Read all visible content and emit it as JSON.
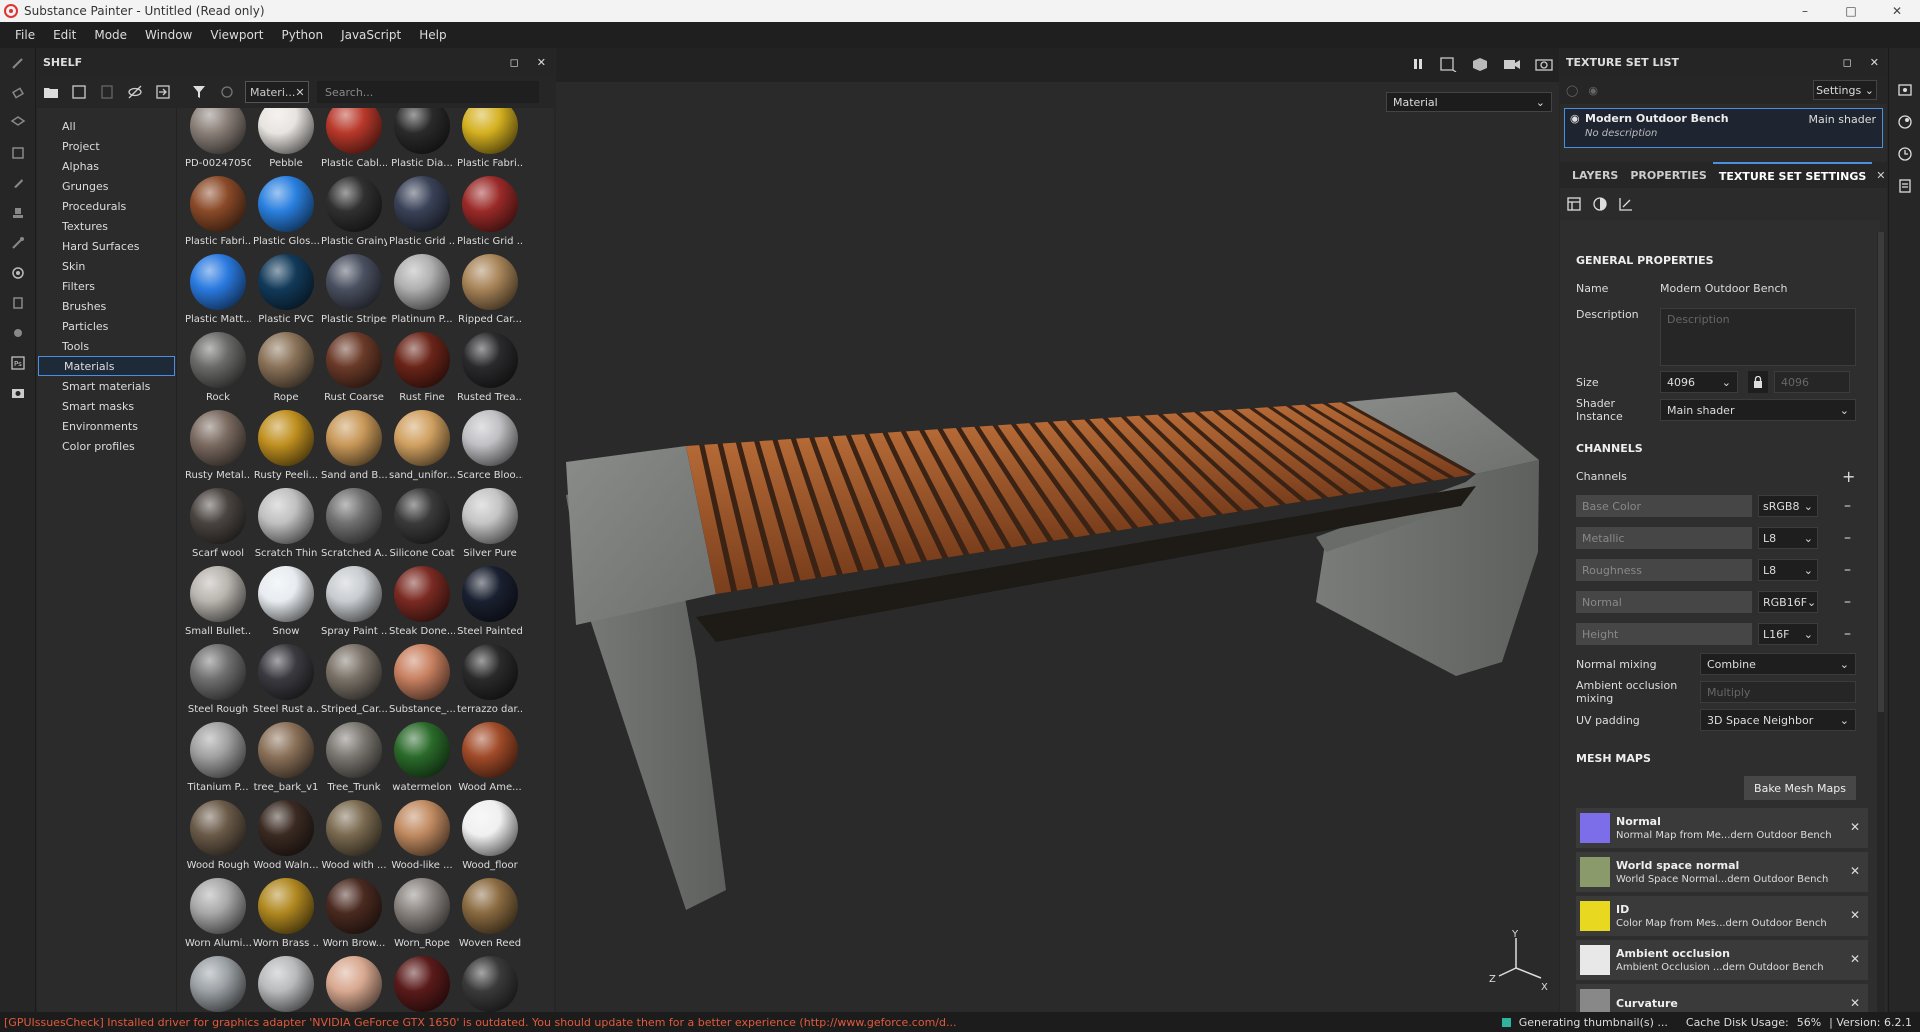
{
  "window": {
    "title": "Substance Painter - Untitled (Read only)"
  },
  "menu": [
    "File",
    "Edit",
    "Mode",
    "Window",
    "Viewport",
    "Python",
    "JavaScript",
    "Help"
  ],
  "shelf": {
    "title": "SHELF",
    "filter_chip": "Materi...",
    "search_placeholder": "Search...",
    "categories": [
      "All",
      "Project",
      "Alphas",
      "Grunges",
      "Procedurals",
      "Textures",
      "Hard Surfaces",
      "Skin",
      "Filters",
      "Brushes",
      "Particles",
      "Tools",
      "Materials",
      "Smart materials",
      "Smart masks",
      "Environments",
      "Color profiles"
    ],
    "selected_category": "Materials",
    "materials": [
      {
        "name": "PD-00247050",
        "color": "#8a7f78"
      },
      {
        "name": "Pebble",
        "color": "#e8e4e0"
      },
      {
        "name": "Plastic Cabl...",
        "color": "#b8382a"
      },
      {
        "name": "Plastic Dia...",
        "color": "#2a2a2a"
      },
      {
        "name": "Plastic Fabri...",
        "color": "#d4b020"
      },
      {
        "name": "Plastic Fabri...",
        "color": "#8a4a28"
      },
      {
        "name": "Plastic Glos...",
        "color": "#2a80e0"
      },
      {
        "name": "Plastic Grainy",
        "color": "#303030"
      },
      {
        "name": "Plastic Grid ...",
        "color": "#3a4258"
      },
      {
        "name": "Plastic Grid ...",
        "color": "#9a2a28"
      },
      {
        "name": "Plastic Matt...",
        "color": "#2a7ae0"
      },
      {
        "name": "Plastic PVC",
        "color": "#123a5a"
      },
      {
        "name": "Plastic Stripes",
        "color": "#4a5060"
      },
      {
        "name": "Platinum P...",
        "color": "#b0b0b0"
      },
      {
        "name": "Ripped Car...",
        "color": "#a88458"
      },
      {
        "name": "Rock",
        "color": "#6a6a68"
      },
      {
        "name": "Rope",
        "color": "#8a7258"
      },
      {
        "name": "Rust Coarse",
        "color": "#6a3a28"
      },
      {
        "name": "Rust Fine",
        "color": "#6a2418"
      },
      {
        "name": "Rusted Trea...",
        "color": "#2a2a2c"
      },
      {
        "name": "Rusty Metal...",
        "color": "#7a6a60"
      },
      {
        "name": "Rusty Peeli...",
        "color": "#c09020"
      },
      {
        "name": "Sand and B...",
        "color": "#c89858"
      },
      {
        "name": "sand_unifor...",
        "color": "#d0a060"
      },
      {
        "name": "Scarce Bloo...",
        "color": "#c0c0c4"
      },
      {
        "name": "Scarf wool",
        "color": "#4a4440"
      },
      {
        "name": "Scratch Thin",
        "color": "#c0c0c0"
      },
      {
        "name": "Scratched A...",
        "color": "#707070"
      },
      {
        "name": "Silicone Coat",
        "color": "#3a3a3a"
      },
      {
        "name": "Silver Pure",
        "color": "#c4c4c4"
      },
      {
        "name": "Small Bullet...",
        "color": "#b8b4ae"
      },
      {
        "name": "Snow",
        "color": "#e8ecf0"
      },
      {
        "name": "Spray Paint ...",
        "color": "#c8ccd0"
      },
      {
        "name": "Steak Done...",
        "color": "#7a2a22"
      },
      {
        "name": "Steel Painted",
        "color": "#1a2030"
      },
      {
        "name": "Steel Rough",
        "color": "#707070"
      },
      {
        "name": "Steel Rust a...",
        "color": "#3a3a40"
      },
      {
        "name": "Striped_Car...",
        "color": "#7a7268"
      },
      {
        "name": "Substance_...",
        "color": "#c88060"
      },
      {
        "name": "terrazzo dar...",
        "color": "#2a2a2a"
      },
      {
        "name": "Titanium P...",
        "color": "#a0a0a0"
      },
      {
        "name": "tree_bark_v1",
        "color": "#8a7058"
      },
      {
        "name": "Tree_Trunk",
        "color": "#7a7670"
      },
      {
        "name": "watermelon",
        "color": "#2a6a2a"
      },
      {
        "name": "Wood Ame...",
        "color": "#a04a28"
      },
      {
        "name": "Wood Rough",
        "color": "#6a5a48"
      },
      {
        "name": "Wood Waln...",
        "color": "#3a2a22"
      },
      {
        "name": "Wood with ...",
        "color": "#7a6a50"
      },
      {
        "name": "Wood-like ...",
        "color": "#c08a60"
      },
      {
        "name": "Wood_floor",
        "color": "#f0f0f0"
      },
      {
        "name": "Worn Alumi...",
        "color": "#a8a8a8"
      },
      {
        "name": "Worn Brass ...",
        "color": "#b08820"
      },
      {
        "name": "Worn Brow...",
        "color": "#4a2a20"
      },
      {
        "name": "Worn_Rope",
        "color": "#8a8480"
      },
      {
        "name": "Woven Reed",
        "color": "#8a6a40"
      },
      {
        "name": "",
        "color": "#9aa0a4"
      },
      {
        "name": "",
        "color": "#b8babc"
      },
      {
        "name": "",
        "color": "#d8a890"
      },
      {
        "name": "",
        "color": "#5a1a1a"
      },
      {
        "name": "",
        "color": "#3a3a3a"
      }
    ]
  },
  "viewport": {
    "channel_select": "Material"
  },
  "texture_set_list": {
    "title": "TEXTURE SET LIST",
    "settings_label": "Settings",
    "item": {
      "name": "Modern Outdoor Bench",
      "shader": "Main shader",
      "description": "No description"
    }
  },
  "tabs": {
    "layers": "LAYERS",
    "properties": "PROPERTIES",
    "tss": "TEXTURE SET SETTINGS"
  },
  "general": {
    "section": "GENERAL PROPERTIES",
    "name_label": "Name",
    "name_value": "Modern Outdoor Bench",
    "description_label": "Description",
    "description_placeholder": "Description",
    "size_label": "Size",
    "size_value": "4096",
    "size_value2": "4096",
    "shader_label": "Shader Instance",
    "shader_value": "Main shader"
  },
  "channels": {
    "section": "CHANNELS",
    "label": "Channels",
    "list": [
      {
        "name": "Base Color",
        "format": "sRGB8"
      },
      {
        "name": "Metallic",
        "format": "L8"
      },
      {
        "name": "Roughness",
        "format": "L8"
      },
      {
        "name": "Normal",
        "format": "RGB16F"
      },
      {
        "name": "Height",
        "format": "L16F"
      }
    ],
    "normal_mixing_label": "Normal mixing",
    "normal_mixing_value": "Combine",
    "ao_mixing_label": "Ambient occlusion mixing",
    "ao_mixing_value": "Multiply",
    "uv_padding_label": "UV padding",
    "uv_padding_value": "3D Space Neighbor"
  },
  "mesh_maps": {
    "section": "MESH MAPS",
    "bake_label": "Bake Mesh Maps",
    "maps": [
      {
        "title": "Normal",
        "sub": "Normal Map from Me...dern Outdoor Bench",
        "color": "#7b6ee8"
      },
      {
        "title": "World space normal",
        "sub": "World Space Normal...dern Outdoor Bench",
        "color": "#8a9a6a"
      },
      {
        "title": "ID",
        "sub": "Color Map from Mes...dern Outdoor Bench",
        "color": "#e8d820"
      },
      {
        "title": "Ambient occlusion",
        "sub": "Ambient Occlusion ...dern Outdoor Bench",
        "color": "#e8e8e8"
      },
      {
        "title": "Curvature",
        "sub": "",
        "color": "#888888"
      }
    ]
  },
  "status": {
    "error": "[GPUIssuesCheck] Installed driver for graphics adapter 'NVIDIA GeForce GTX 1650' is outdated. You should update them for a better experience (http://www.geforce.com/d...",
    "generating": "Generating thumbnail(s) ...",
    "cache": "Cache Disk Usage:",
    "cache_value": "56%",
    "version": "| Version: 6.2.1"
  }
}
